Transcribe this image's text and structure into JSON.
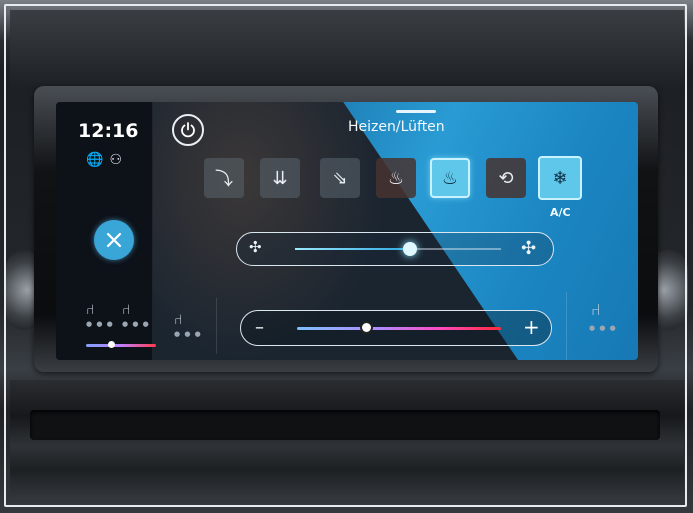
{
  "status": {
    "time": "12:16",
    "icons": [
      "globe-icon",
      "person-icon"
    ]
  },
  "header": {
    "title": "Heizen/Lüften"
  },
  "modes": [
    {
      "name": "air-to-feet",
      "icon": "seat-airflow-down-icon",
      "active": false
    },
    {
      "name": "air-to-feet-and-body",
      "icon": "seat-airflow-body-feet-icon",
      "active": false
    },
    {
      "name": "air-to-body",
      "icon": "seat-airflow-body-icon",
      "active": false
    },
    {
      "name": "defrost-windshield",
      "icon": "windshield-defrost-icon",
      "active": false
    },
    {
      "name": "windshield-and-feet",
      "icon": "windshield-feet-icon",
      "active": true
    },
    {
      "name": "recirculation",
      "icon": "car-recirculation-icon",
      "active": false
    },
    {
      "name": "ac",
      "icon": "snowflake-icon",
      "active": true
    }
  ],
  "ac_label": "A/C",
  "fan": {
    "level": 0.56
  },
  "temperature": {
    "minus_label": "–",
    "plus_label": "+",
    "level": 0.34
  },
  "colors": {
    "accent": "#5fc7e9",
    "screen_blue": "#2a9bd4"
  }
}
